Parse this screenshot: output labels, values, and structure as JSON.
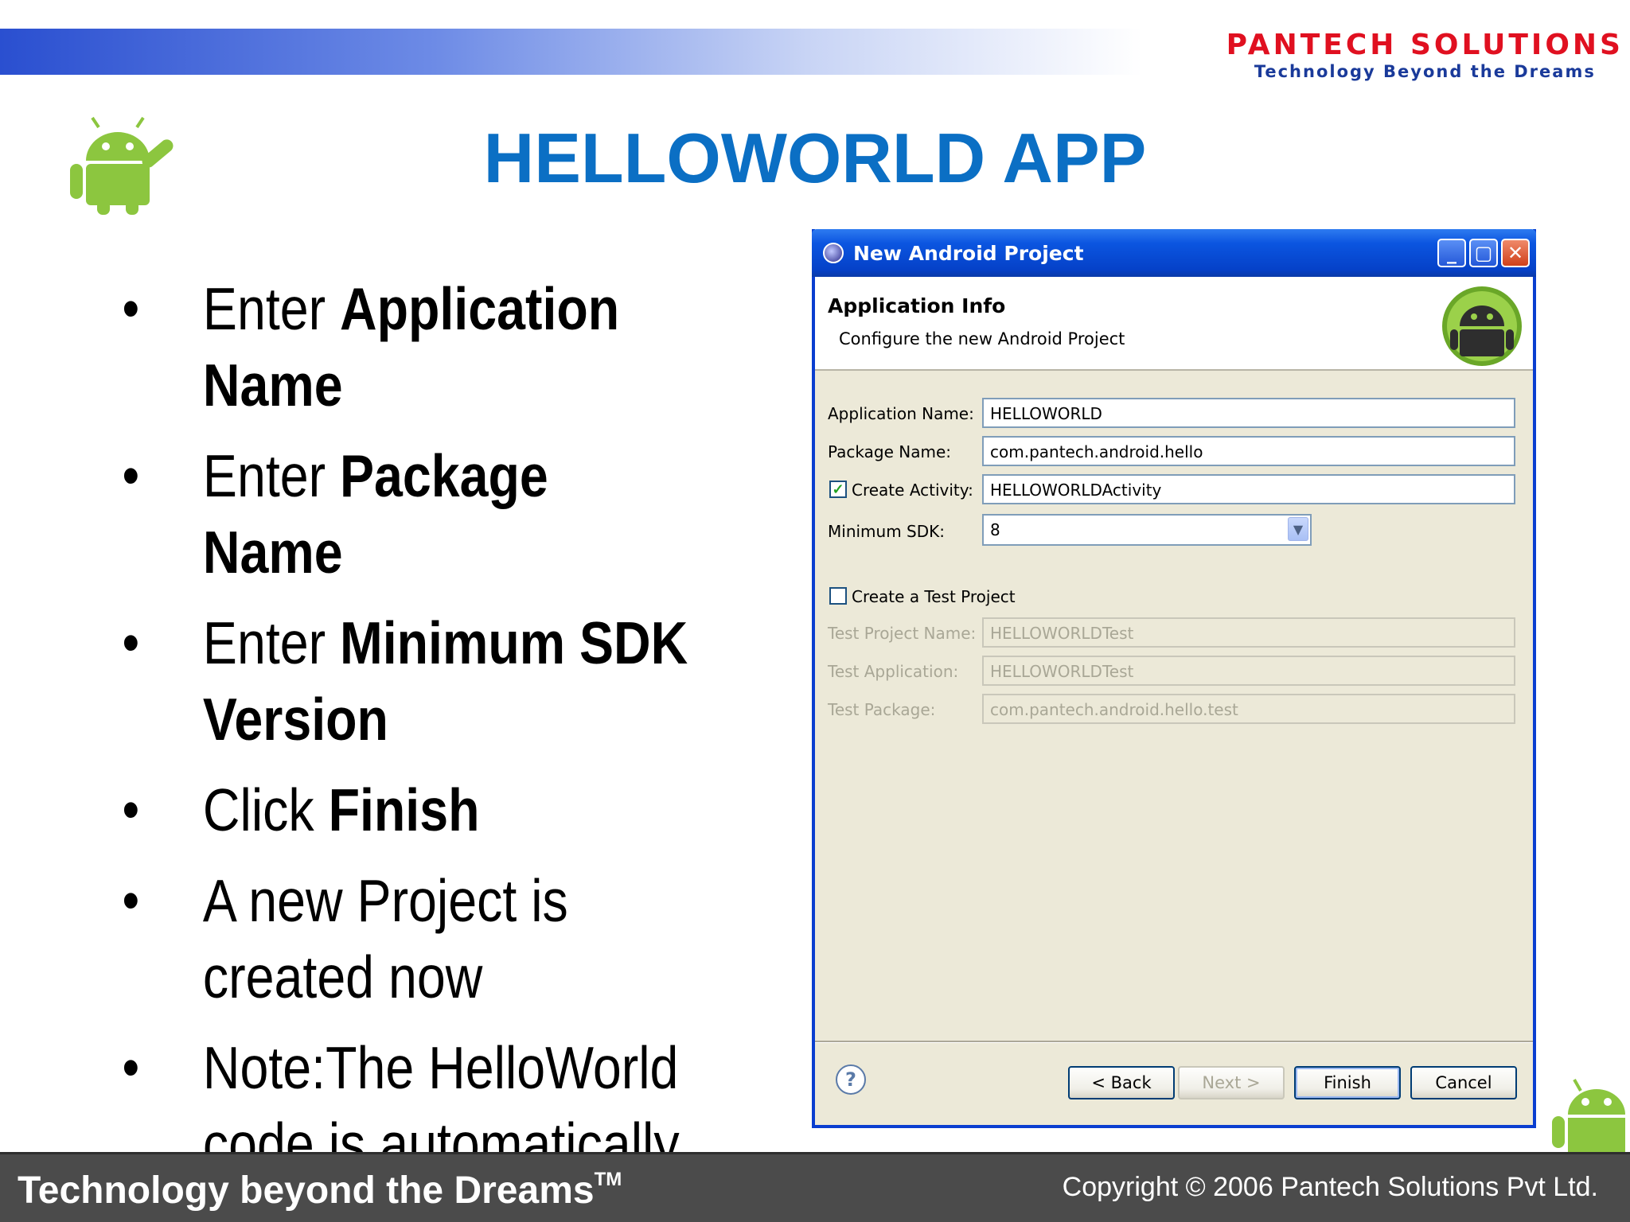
{
  "logo": {
    "name": "PANTECH SOLUTIONS",
    "tagline": "Technology Beyond the Dreams"
  },
  "slide": {
    "title": "HELLOWORLD APP",
    "bullets": [
      {
        "pre": "Enter ",
        "bold": "Application Name"
      },
      {
        "pre": "Enter ",
        "bold": "Package Name"
      },
      {
        "pre": "Enter ",
        "bold": "Minimum SDK Version"
      },
      {
        "pre": "Click ",
        "bold": "Finish"
      },
      {
        "pre": "A new Project is created now",
        "bold": ""
      },
      {
        "pre": "Note:The HelloWorld code is automatically generated by Eclipse",
        "bold": ""
      }
    ]
  },
  "dialog": {
    "title": "New Android Project",
    "header_title": "Application Info",
    "header_subtitle": "Configure the new Android Project",
    "app_name_label": "Application Name:",
    "app_name_value": "HELLOWORLD",
    "package_label": "Package Name:",
    "package_value": "com.pantech.android.hello",
    "create_activity_label": "Create Activity:",
    "create_activity_checked": true,
    "activity_value": "HELLOWORLDActivity",
    "min_sdk_label": "Minimum SDK:",
    "min_sdk_value": "8",
    "create_test_label": "Create a Test Project",
    "create_test_checked": false,
    "test_project_label": "Test Project Name:",
    "test_project_value": "HELLOWORLDTest",
    "test_app_label": "Test Application:",
    "test_app_value": "HELLOWORLDTest",
    "test_package_label": "Test Package:",
    "test_package_value": "com.pantech.android.hello.test",
    "help_label": "?",
    "back_label": "< Back",
    "next_label": "Next >",
    "finish_label": "Finish",
    "cancel_label": "Cancel"
  },
  "footer": {
    "left": "Technology beyond the Dreams",
    "trademark": "TM",
    "right": "Copyright © 2006 Pantech Solutions Pvt Ltd."
  },
  "colors": {
    "title": "#0b6fc4",
    "titlebar": "#0541c8",
    "footer": "#4b4b4b",
    "android_green": "#8cc63f"
  },
  "icons": [
    "android-robot-icon",
    "android-badge-icon",
    "eclipse-icon",
    "minimize-icon",
    "maximize-icon",
    "close-icon",
    "help-icon",
    "checkmark-icon",
    "chevron-down-icon"
  ]
}
